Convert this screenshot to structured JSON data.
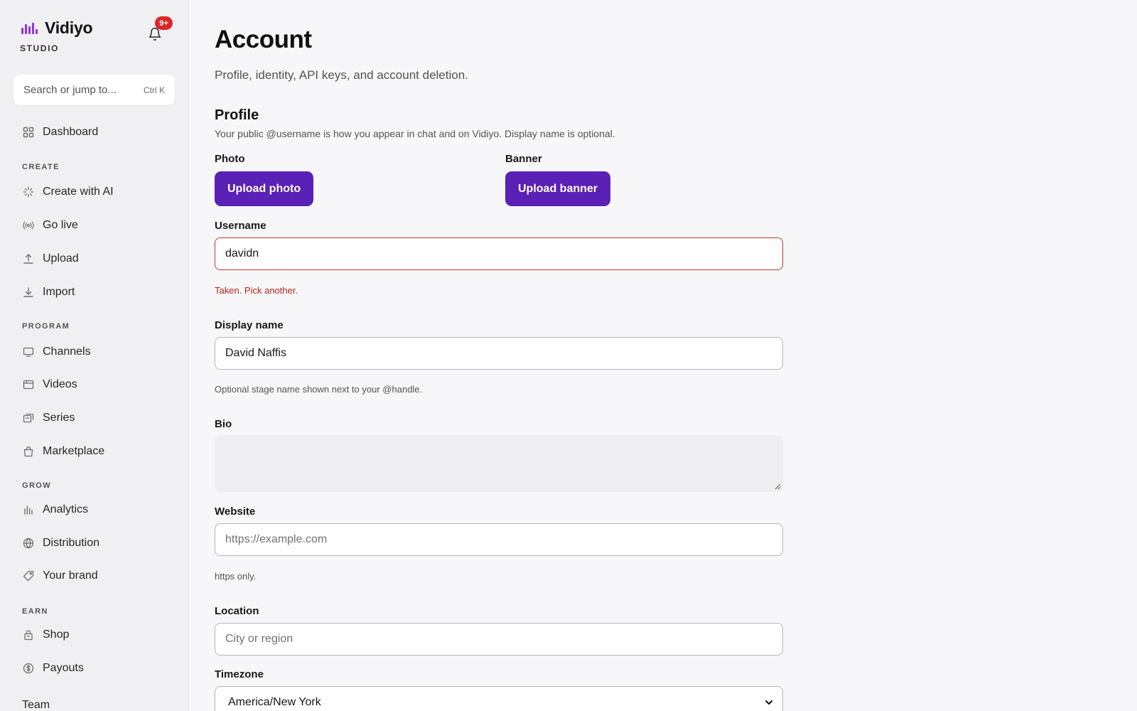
{
  "brand": {
    "name": "Vidiyo",
    "sub": "STUDIO"
  },
  "notifications": {
    "badge": "9+"
  },
  "search": {
    "placeholder": "Search or jump to...",
    "shortcut": "Ctrl K"
  },
  "nav": {
    "dashboard": "Dashboard",
    "sections": {
      "create": "CREATE",
      "program": "PROGRAM",
      "grow": "GROW",
      "earn": "EARN"
    },
    "create": [
      "Create with AI",
      "Go live",
      "Upload",
      "Import"
    ],
    "program": [
      "Channels",
      "Videos",
      "Series",
      "Marketplace"
    ],
    "grow": [
      "Analytics",
      "Distribution",
      "Your brand"
    ],
    "earn": [
      "Shop",
      "Payouts"
    ],
    "team": "Team"
  },
  "page": {
    "title": "Account",
    "subtitle": "Profile, identity, API keys, and account deletion."
  },
  "profile": {
    "title": "Profile",
    "description": "Your public @username is how you appear in chat and on Vidiyo. Display name is optional.",
    "photo_label": "Photo",
    "photo_button": "Upload photo",
    "banner_label": "Banner",
    "banner_button": "Upload banner",
    "username_label": "Username",
    "username_value": "davidn",
    "username_error": "Taken. Pick another.",
    "display_name_label": "Display name",
    "display_name_value": "David Naffis",
    "display_name_help": "Optional stage name shown next to your @handle.",
    "bio_label": "Bio",
    "bio_value": "",
    "website_label": "Website",
    "website_placeholder": "https://example.com",
    "website_help": "https only.",
    "location_label": "Location",
    "location_placeholder": "City or region",
    "timezone_label": "Timezone",
    "timezone_value": "America/New York"
  },
  "colors": {
    "accent": "#5b21b6",
    "brand_logo": "#9333ea",
    "error": "#b42318",
    "badge": "#dc2626"
  }
}
